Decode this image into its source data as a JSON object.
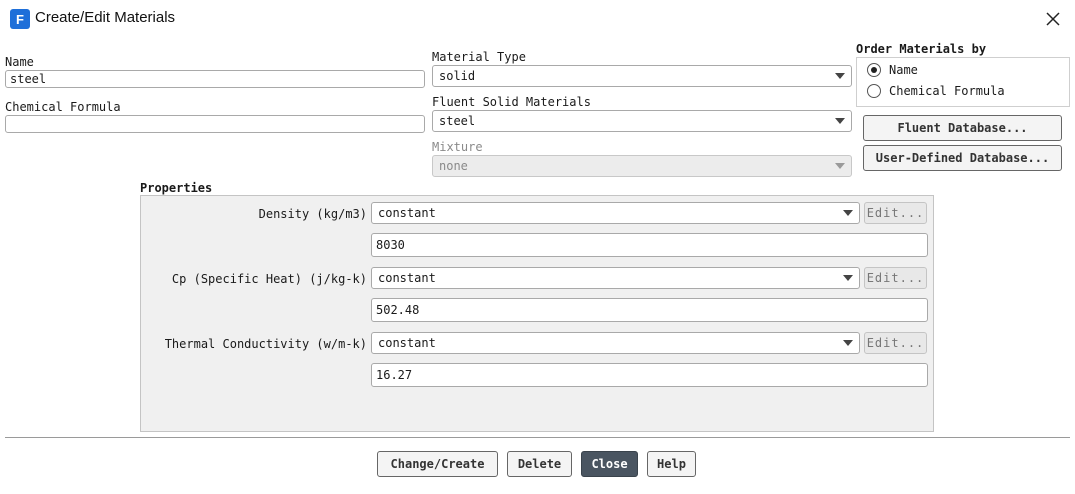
{
  "window": {
    "title": "Create/Edit Materials",
    "app_icon_letter": "F"
  },
  "name": {
    "label": "Name",
    "value": "steel"
  },
  "chemical_formula": {
    "label": "Chemical Formula",
    "value": ""
  },
  "material_type": {
    "label": "Material Type",
    "value": "solid"
  },
  "fluent_solid_materials": {
    "label": "Fluent Solid Materials",
    "value": "steel"
  },
  "mixture": {
    "label": "Mixture",
    "value": "none"
  },
  "order_by": {
    "label": "Order Materials by",
    "options": [
      "Name",
      "Chemical Formula"
    ],
    "selected": "Name"
  },
  "database_buttons": {
    "fluent": "Fluent Database...",
    "user": "User-Defined Database..."
  },
  "properties": {
    "title": "Properties",
    "items": [
      {
        "label": "Density (kg/m3)",
        "method": "constant",
        "value": "8030",
        "edit": "Edit..."
      },
      {
        "label": "Cp (Specific Heat) (j/kg-k)",
        "method": "constant",
        "value": "502.48",
        "edit": "Edit..."
      },
      {
        "label": "Thermal Conductivity (w/m-k)",
        "method": "constant",
        "value": "16.27",
        "edit": "Edit..."
      }
    ]
  },
  "footer": {
    "change_create": "Change/Create",
    "delete": "Delete",
    "close": "Close",
    "help": "Help"
  }
}
